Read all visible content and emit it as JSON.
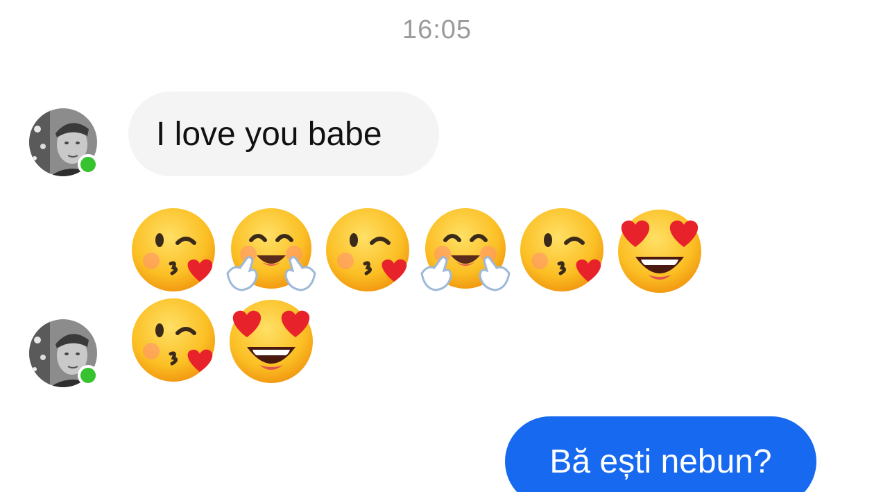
{
  "conversation": {
    "timestamp": "16:05",
    "messages": [
      {
        "sender": "contact",
        "type": "text",
        "text": "I love you babe"
      },
      {
        "sender": "contact",
        "type": "emoji",
        "emojis": [
          "face-blowing-a-kiss",
          "smiling-face-with-open-hands",
          "face-blowing-a-kiss",
          "smiling-face-with-open-hands",
          "face-blowing-a-kiss",
          "smiling-face-with-heart-eyes",
          "face-blowing-a-kiss",
          "smiling-face-with-heart-eyes"
        ]
      },
      {
        "sender": "me",
        "type": "text",
        "text": "Bă ești nebun?"
      }
    ]
  },
  "contact": {
    "online": true,
    "presence_color": "#37c22f"
  },
  "colors": {
    "outgoing_bubble": "#1769f0",
    "incoming_bubble": "#f4f4f4",
    "timestamp": "#9a9a9a"
  }
}
